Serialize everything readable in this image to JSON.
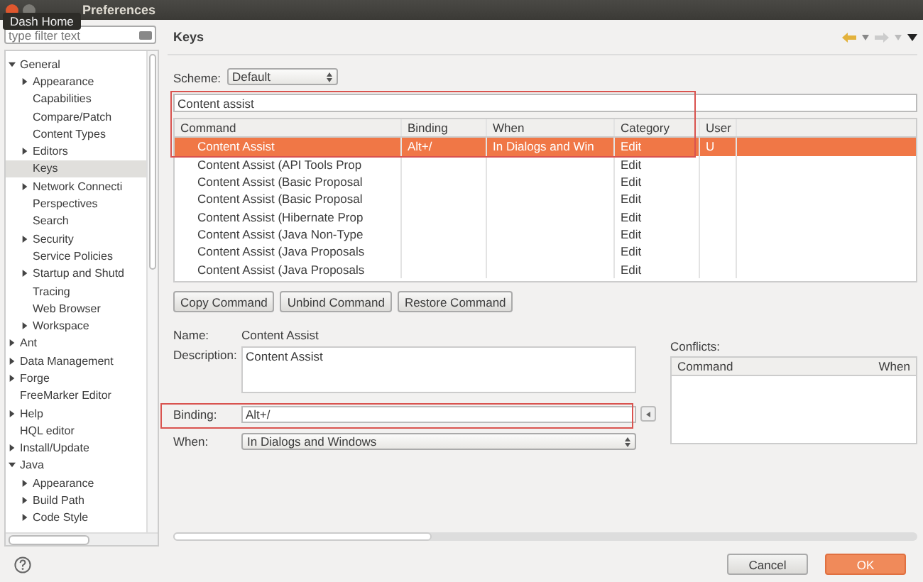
{
  "window": {
    "title": "Preferences"
  },
  "tooltip": "Dash Home",
  "sidebar": {
    "filter": {
      "placeholder": "type filter text"
    },
    "tree": [
      {
        "label": "General",
        "expanded": true,
        "selected": false,
        "children": [
          {
            "label": "Appearance",
            "expanded": false,
            "selected": false
          },
          {
            "label": "Capabilities",
            "selected": false
          },
          {
            "label": "Compare/Patch",
            "selected": false
          },
          {
            "label": "Content Types",
            "selected": false
          },
          {
            "label": "Editors",
            "expanded": false,
            "selected": false
          },
          {
            "label": "Keys",
            "selected": true
          },
          {
            "label": "Network Connecti",
            "expanded": false,
            "selected": false
          },
          {
            "label": "Perspectives",
            "selected": false
          },
          {
            "label": "Search",
            "selected": false
          },
          {
            "label": "Security",
            "expanded": false,
            "selected": false
          },
          {
            "label": "Service Policies",
            "selected": false
          },
          {
            "label": "Startup and Shutd",
            "expanded": false,
            "selected": false
          },
          {
            "label": "Tracing",
            "selected": false
          },
          {
            "label": "Web Browser",
            "selected": false
          },
          {
            "label": "Workspace",
            "expanded": false,
            "selected": false
          }
        ]
      },
      {
        "label": "Ant",
        "expanded": false,
        "selected": false
      },
      {
        "label": "Data Management",
        "expanded": false,
        "selected": false
      },
      {
        "label": "Forge",
        "expanded": false,
        "selected": false
      },
      {
        "label": "FreeMarker Editor",
        "selected": false
      },
      {
        "label": "Help",
        "expanded": false,
        "selected": false
      },
      {
        "label": "HQL editor",
        "selected": false
      },
      {
        "label": "Install/Update",
        "expanded": false,
        "selected": false
      },
      {
        "label": "Java",
        "expanded": true,
        "selected": false,
        "children": [
          {
            "label": "Appearance",
            "expanded": false,
            "selected": false
          },
          {
            "label": "Build Path",
            "expanded": false,
            "selected": false
          },
          {
            "label": "Code Style",
            "expanded": false,
            "selected": false
          }
        ]
      }
    ]
  },
  "page": {
    "title": "Keys",
    "scheme_label": "Scheme:",
    "scheme": "Default",
    "filter": "Content assist",
    "table": {
      "columns": [
        "Command",
        "Binding",
        "When",
        "Category",
        "User"
      ],
      "rows": [
        {
          "cells": [
            "Content Assist",
            "Alt+/",
            "In Dialogs and Win",
            "Edit",
            "U"
          ],
          "selected": true
        },
        {
          "cells": [
            "Content Assist (API Tools Prop",
            "",
            "",
            "Edit",
            ""
          ],
          "selected": false
        },
        {
          "cells": [
            "Content Assist (Basic Proposal",
            "",
            "",
            "Edit",
            ""
          ],
          "selected": false
        },
        {
          "cells": [
            "Content Assist (Basic Proposal",
            "",
            "",
            "Edit",
            ""
          ],
          "selected": false
        },
        {
          "cells": [
            "Content Assist (Hibernate Prop",
            "",
            "",
            "Edit",
            ""
          ],
          "selected": false
        },
        {
          "cells": [
            "Content Assist (Java Non-Type",
            "",
            "",
            "Edit",
            ""
          ],
          "selected": false
        },
        {
          "cells": [
            "Content Assist (Java Proposals",
            "",
            "",
            "Edit",
            ""
          ],
          "selected": false
        },
        {
          "cells": [
            "Content Assist (Java Proposals",
            "",
            "",
            "Edit",
            ""
          ],
          "selected": false
        }
      ]
    },
    "buttons": [
      "Copy Command",
      "Unbind Command",
      "Restore Command"
    ],
    "name_label": "Name:",
    "name": "Content Assist",
    "description_label": "Description:",
    "description": "Content Assist",
    "binding_label": "Binding:",
    "binding": "Alt+/",
    "when_label": "When:",
    "when": "In Dialogs and Windows",
    "conflicts": {
      "label": "Conflicts:",
      "columns": [
        "Command",
        "When"
      ]
    }
  },
  "footer": {
    "buttons": [
      {
        "label": "Cancel",
        "kind": "normal"
      },
      {
        "label": "OK",
        "kind": "default"
      }
    ]
  }
}
